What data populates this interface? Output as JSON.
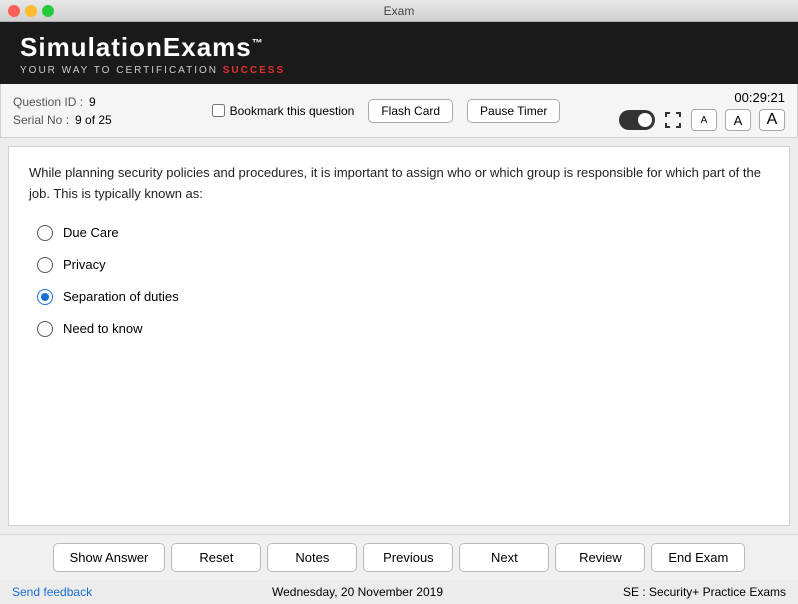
{
  "window": {
    "title": "Exam"
  },
  "brand": {
    "name": "SimulationExams",
    "tm": "™",
    "tagline_pre": "YOUR ",
    "tagline_way": "WAY",
    "tagline_mid": " TO CERTIFICATION ",
    "tagline_success": "SUCCESS"
  },
  "question_info": {
    "question_id_label": "Question ID :",
    "question_id_value": "9",
    "serial_no_label": "Serial No :",
    "serial_no_value": "9 of 25",
    "bookmark_label": "Bookmark this question",
    "flash_card_label": "Flash Card",
    "pause_timer_label": "Pause Timer",
    "timer_value": "00:29:21",
    "font_a_small": "A",
    "font_a_medium": "A",
    "font_a_large": "A"
  },
  "question": {
    "text": "While planning security policies and procedures, it is important to assign who or which group is responsible for which part of the job. This is typically known as:"
  },
  "options": [
    {
      "id": "a",
      "text": "Due Care",
      "selected": false
    },
    {
      "id": "b",
      "text": "Privacy",
      "selected": false
    },
    {
      "id": "c",
      "text": "Separation of duties",
      "selected": true
    },
    {
      "id": "d",
      "text": "Need to know",
      "selected": false
    }
  ],
  "nav_buttons": {
    "show_answer": "Show Answer",
    "reset": "Reset",
    "notes": "Notes",
    "previous": "Previous",
    "next": "Next",
    "review": "Review",
    "end_exam": "End Exam"
  },
  "footer": {
    "feedback_label": "Send feedback",
    "date_text": "Wednesday, 20 November 2019",
    "product_text": "SE : Security+ Practice Exams"
  }
}
